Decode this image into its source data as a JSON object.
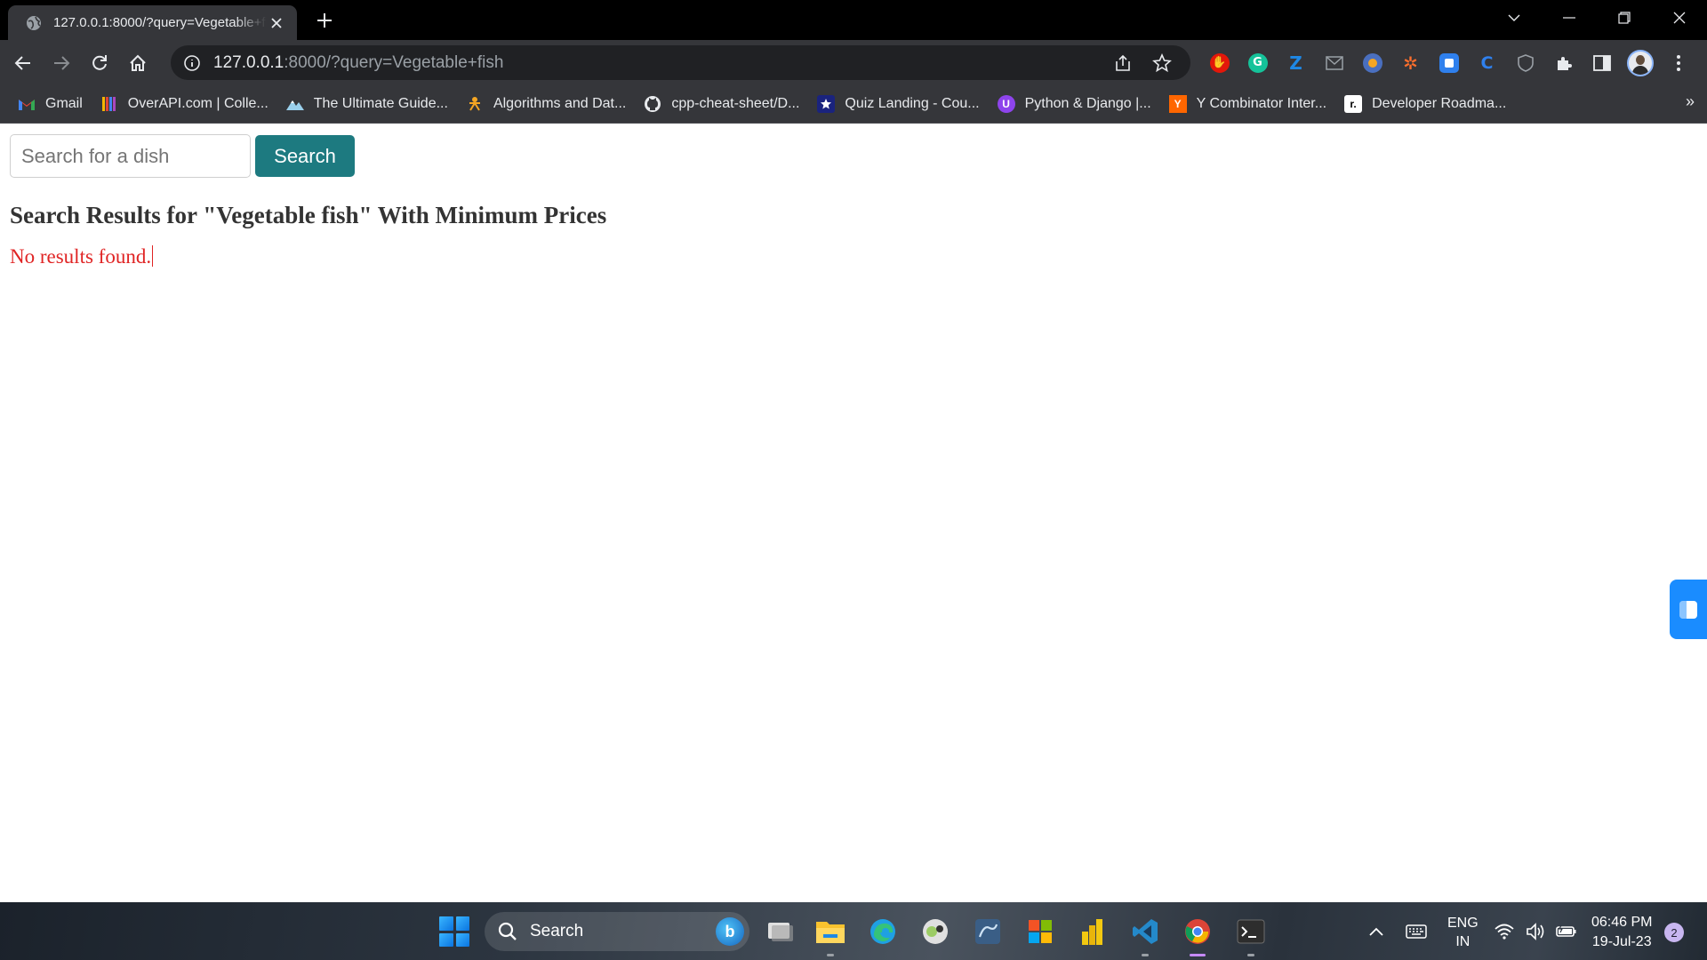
{
  "browser": {
    "tab_title": "127.0.0.1:8000/?query=Vegetable+fish",
    "url_host": "127.0.0.1",
    "url_rest": ":8000/?query=Vegetable+fish",
    "bookmarks": [
      {
        "label": "Gmail",
        "icon": "gmail-icon"
      },
      {
        "label": "OverAPI.com | Colle...",
        "icon": "overapi-icon"
      },
      {
        "label": "The Ultimate Guide...",
        "icon": "mountain-icon"
      },
      {
        "label": "Algorithms and Dat...",
        "icon": "algorithms-icon"
      },
      {
        "label": "cpp-cheat-sheet/D...",
        "icon": "github-icon"
      },
      {
        "label": "Quiz Landing - Cou...",
        "icon": "star-icon"
      },
      {
        "label": "Python & Django |...",
        "icon": "python-django-icon"
      },
      {
        "label": "Y Combinator Inter...",
        "icon": "ycombinator-icon"
      },
      {
        "label": "Developer Roadma...",
        "icon": "roadmap-icon"
      }
    ],
    "bookmarks_overflow": "»"
  },
  "page": {
    "search_placeholder": "Search for a dish",
    "search_value": "",
    "search_button": "Search",
    "results_heading": "Search Results for \"Vegetable fish\" With Minimum Prices",
    "no_results": "No results found."
  },
  "taskbar": {
    "search_label": "Search",
    "lang_primary": "ENG",
    "lang_secondary": "IN",
    "time": "06:46 PM",
    "date": "19-Jul-23",
    "notification_count": "2"
  },
  "colors": {
    "search_button_bg": "#1d7a80",
    "no_results_text": "#e02424",
    "heading_text": "#333333"
  }
}
